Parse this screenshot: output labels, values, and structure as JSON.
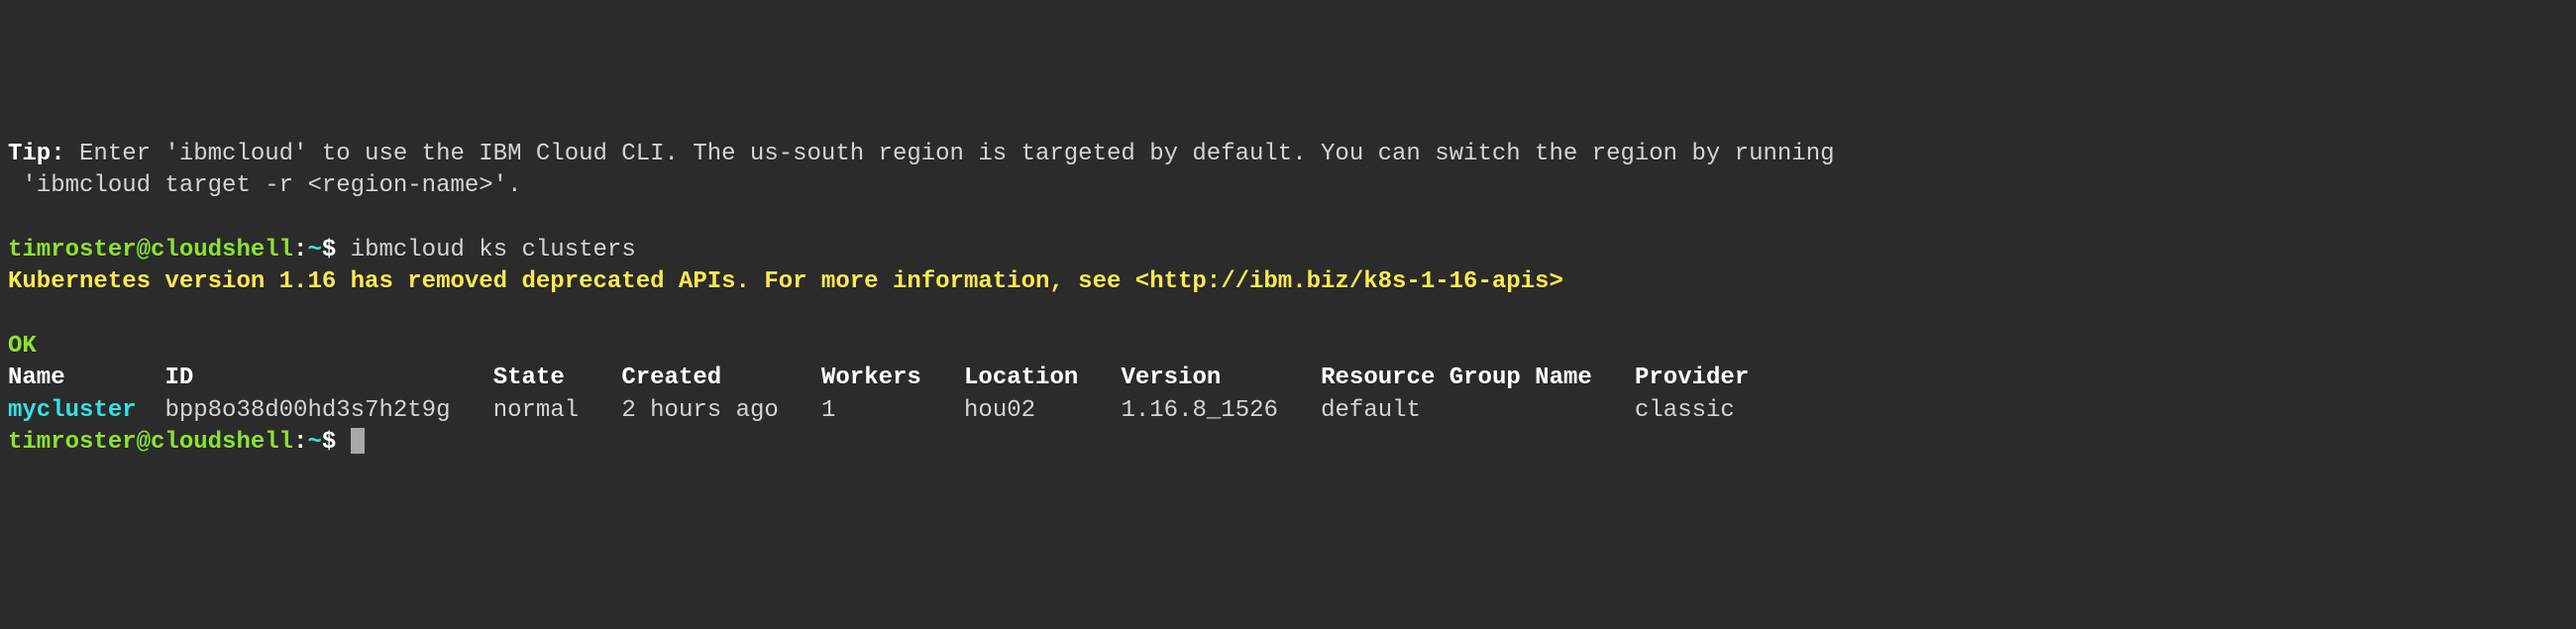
{
  "tip": {
    "label": "Tip:",
    "text_line1": " Enter 'ibmcloud' to use the IBM Cloud CLI. The us-south region is targeted by default. You can switch the region by running",
    "text_line2": " 'ibmcloud target -r <region-name>'."
  },
  "prompt1": {
    "user_host": "timroster@cloudshell",
    "sep": ":",
    "path": "~",
    "dollar": "$ ",
    "command": "ibmcloud ks clusters"
  },
  "warning": "Kubernetes version 1.16 has removed deprecated APIs. For more information, see <http://ibm.biz/k8s-1-16-apis>",
  "ok": "OK",
  "table": {
    "headers": {
      "name": "Name",
      "id": "ID",
      "state": "State",
      "created": "Created",
      "workers": "Workers",
      "location": "Location",
      "version": "Version",
      "resource_group": "Resource Group Name",
      "provider": "Provider"
    },
    "rows": [
      {
        "name": "mycluster",
        "id": "bpp8o38d00hd3s7h2t9g",
        "state": "normal",
        "created": "2 hours ago",
        "workers": "1",
        "location": "hou02",
        "version": "1.16.8_1526",
        "resource_group": "default",
        "provider": "classic"
      }
    ]
  },
  "prompt2": {
    "user_host": "timroster@cloudshell",
    "sep": ":",
    "path": "~",
    "dollar": "$ "
  },
  "spacing": {
    "h_name": "       ",
    "h_id": "                     ",
    "h_state": "    ",
    "h_created": "       ",
    "h_workers": "   ",
    "h_location": "   ",
    "h_version": "       ",
    "h_resource_group": "   ",
    "r_name": "  ",
    "r_id": "   ",
    "r_state": "   ",
    "r_created": "   ",
    "r_workers": "         ",
    "r_location": "      ",
    "r_version": "   ",
    "r_resource_group": "               "
  }
}
